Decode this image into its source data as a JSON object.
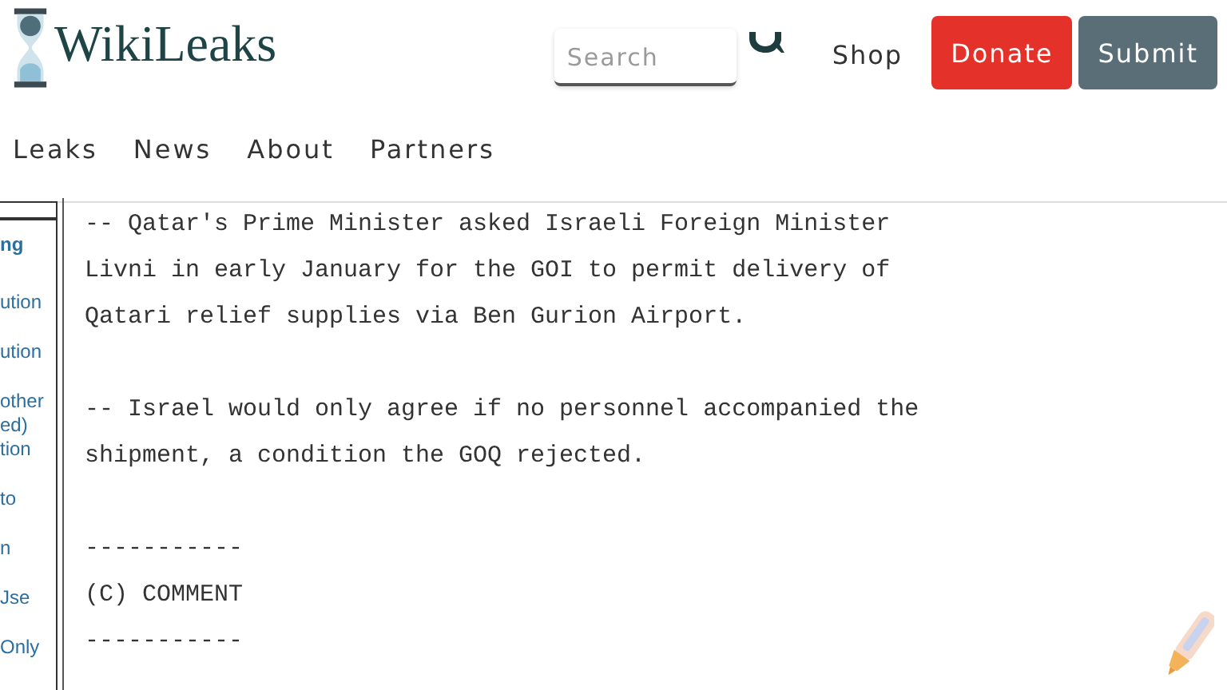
{
  "header": {
    "logo_text": "WikiLeaks",
    "search": {
      "placeholder": "Search"
    },
    "links": [
      "Shop"
    ],
    "buttons": [
      {
        "label": "Donate",
        "kind": "donate"
      },
      {
        "label": "Submit",
        "kind": "submit"
      }
    ]
  },
  "nav": [
    "Leaks",
    "News",
    "About",
    "Partners"
  ],
  "sidebar": {
    "heading": "ng",
    "items": [
      "ution",
      "ution",
      "other\ned)\ntion",
      "to",
      "n",
      "Jse",
      "Only"
    ]
  },
  "cable": [
    "-- Qatar's Prime Minister asked Israeli Foreign Minister\nLivni in early January for the GOI to permit delivery of\nQatari relief supplies via Ben Gurion Airport.",
    "-- Israel would only agree if no personnel accompanied the\nshipment, a condition the GOQ rejected.",
    "-----------\n(C) COMMENT\n-----------"
  ]
}
